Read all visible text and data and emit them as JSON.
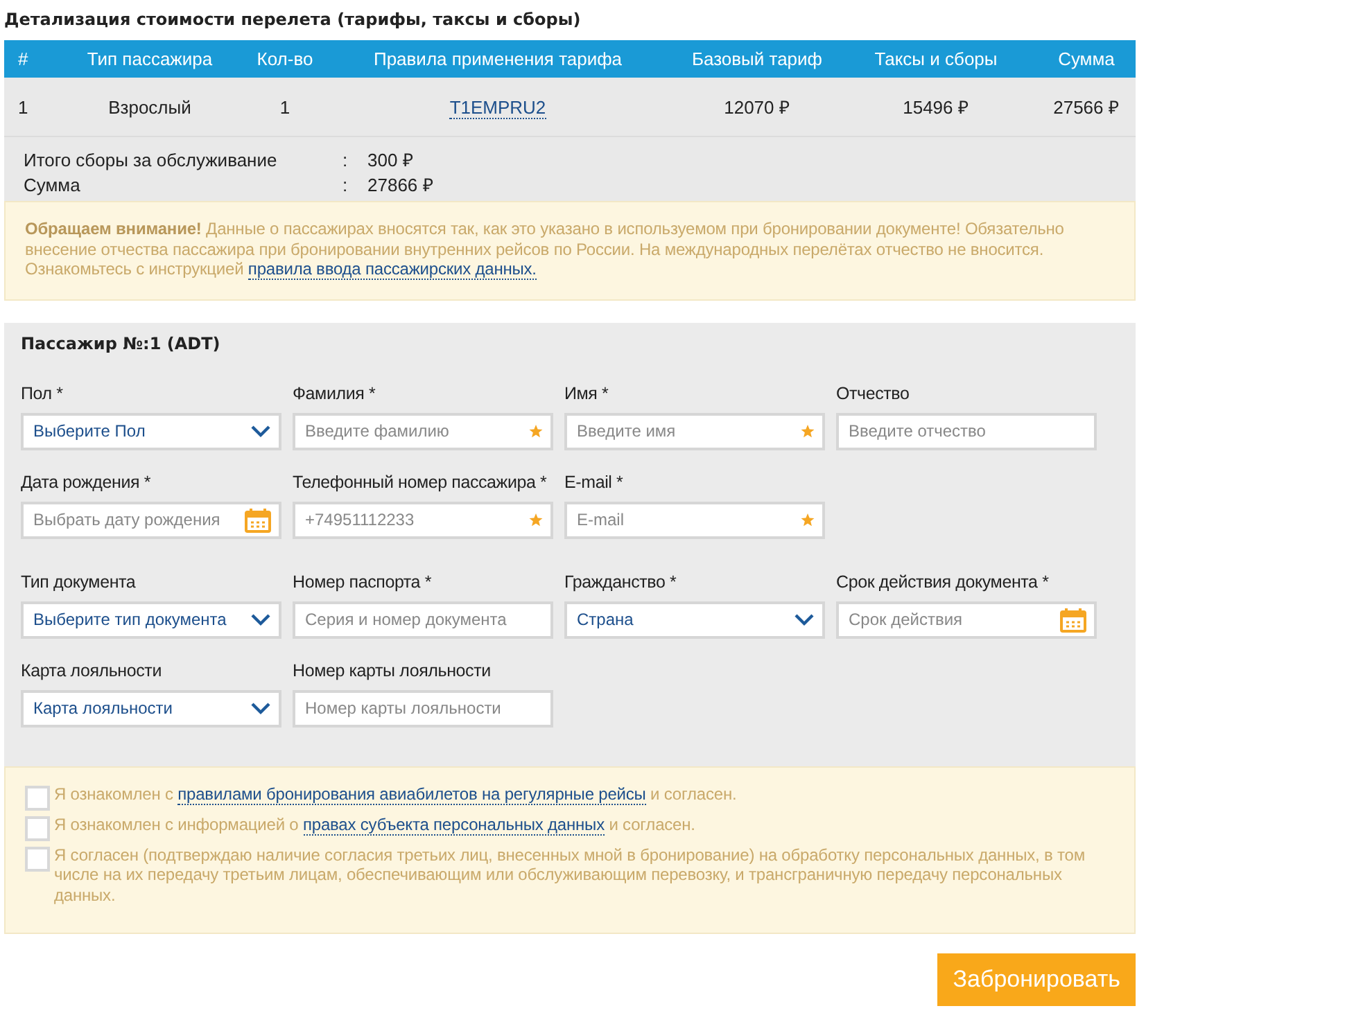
{
  "title": "Детализация стоимости перелета (тарифы, таксы и сборы)",
  "table": {
    "columns": [
      "#",
      "Тип пассажира",
      "Кол-во",
      "Правила применения тарифа",
      "Базовый тариф",
      "Таксы и сборы",
      "Сумма"
    ],
    "rows": [
      [
        {
          "kind": "text",
          "text": "1"
        },
        {
          "kind": "text",
          "text": "Взрослый"
        },
        {
          "kind": "text",
          "text": "1"
        },
        {
          "kind": "link",
          "text": "T1EMPRU2"
        },
        {
          "kind": "text",
          "text": "12070 ₽"
        },
        {
          "kind": "text",
          "text": "15496 ₽"
        },
        {
          "kind": "text",
          "text": "27566 ₽"
        }
      ]
    ]
  },
  "summary": [
    {
      "label": "Итого сборы за обслуживание",
      "separator": ":",
      "value": "300 ₽"
    },
    {
      "label": "Сумма",
      "separator": ":",
      "value": "27866 ₽"
    }
  ],
  "notice": {
    "text": "**Обращаем внимание!** Данные о пассажирах вносятся так, как это указано в используемом при бронировании документе! Обязательно внесение отчества пассажира при бронировании внутренних рейсов по России. На международных перелётах отчество не вносится. Ознакомьтесь с инструкцией ",
    "link": "правила ввода пассажирских данных."
  },
  "passenger": {
    "title": "Пассажир №:1 (ADT)",
    "rows": [
      [
        {
          "label": "Пол *",
          "kind": "select",
          "value": "Выберите Пол"
        },
        {
          "label": "Фамилия *",
          "kind": "required",
          "placeholder": "Введите фамилию"
        },
        {
          "label": "Имя *",
          "kind": "required",
          "placeholder": "Введите имя"
        },
        {
          "label": "Отчество",
          "kind": "text",
          "placeholder": "Введите отчество"
        }
      ],
      [
        {
          "label": "Дата рождения *",
          "kind": "date",
          "placeholder": "Выбрать дату рождения"
        },
        {
          "label": "Телефонный номер пассажира *",
          "kind": "required",
          "placeholder": "+74951112233"
        },
        {
          "label": "E-mail *",
          "kind": "required",
          "placeholder": "E-mail"
        }
      ],
      [
        {
          "label": "Тип документа",
          "kind": "select",
          "value": "Выберите тип документа"
        },
        {
          "label": "Номер паспорта *",
          "kind": "text",
          "placeholder": "Серия и номер документа"
        },
        {
          "label": "Гражданство *",
          "kind": "select",
          "value": "Страна"
        },
        {
          "label": "Срок действия документа *",
          "kind": "date",
          "placeholder": "Срок действия"
        }
      ],
      [
        {
          "label": "Карта лояльности",
          "kind": "select",
          "value": "Карта лояльности"
        },
        {
          "label": "Номер карты лояльности",
          "kind": "text",
          "placeholder": "Номер карты лояльности"
        }
      ]
    ]
  },
  "consents": [
    {
      "checked": false,
      "before": "Я ознакомлен с ",
      "link": "правилами бронирования авиабилетов на регулярные рейсы",
      "after": " и согласен."
    },
    {
      "checked": false,
      "before": "Я ознакомлен с информацией о ",
      "link": "правах субъекта персональных данных",
      "after": " и согласен."
    },
    {
      "checked": false,
      "before": "Я согласен (подтверждаю наличие согласия третьих лиц, внесенных мной в бронирование) на обработку персональных данных, в том числе на их передачу третьим лицам, обеспечивающим или обслуживающим перевозку, и трансграничную передачу персональных данных."
    }
  ],
  "submit": "Забронировать"
}
